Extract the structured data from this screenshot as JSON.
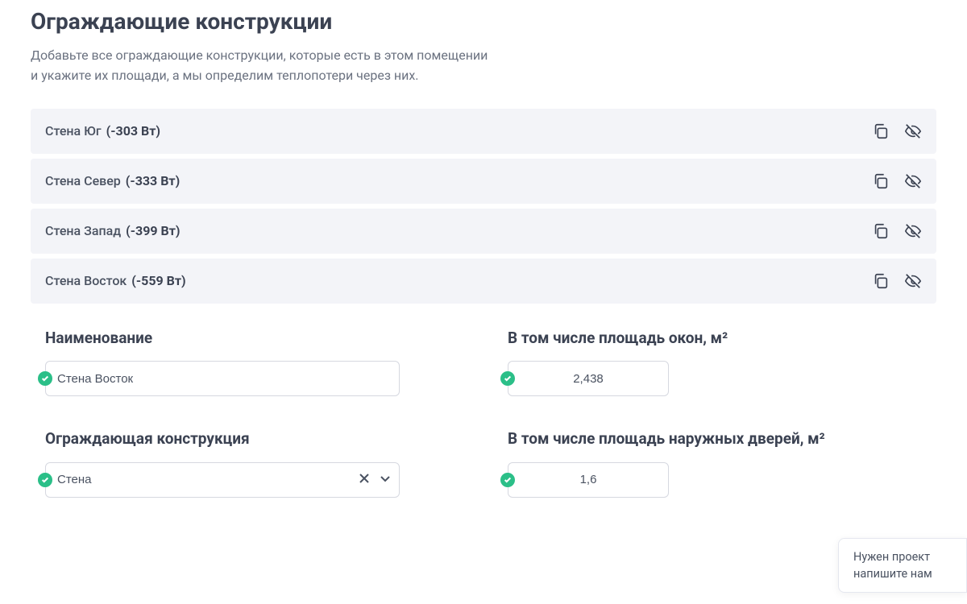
{
  "header": {
    "title": "Ограждающие конструкции",
    "description": "Добавьте все ограждающие конструкции, которые есть в этом помещении и укажите их площади, а мы определим теплопотери через них."
  },
  "rows": [
    {
      "name": "Стена Юг",
      "watt": "(-303 Вт)"
    },
    {
      "name": "Стена Север",
      "watt": "(-333 Вт)"
    },
    {
      "name": "Стена Запад",
      "watt": "(-399 Вт)"
    },
    {
      "name": "Стена Восток",
      "watt": "(-559 Вт)"
    }
  ],
  "form": {
    "name_label": "Наименование",
    "name_value": "Стена Восток",
    "construction_label": "Ограждающая конструкция",
    "construction_value": "Стена",
    "window_area_label": "В том числе площадь окон, м²",
    "window_area_value": "2,438",
    "door_area_label": "В том числе площадь наружных дверей, м²",
    "door_area_value": "1,6"
  },
  "chat": {
    "line1": "Нужен проект",
    "line2": "напишите нам"
  }
}
